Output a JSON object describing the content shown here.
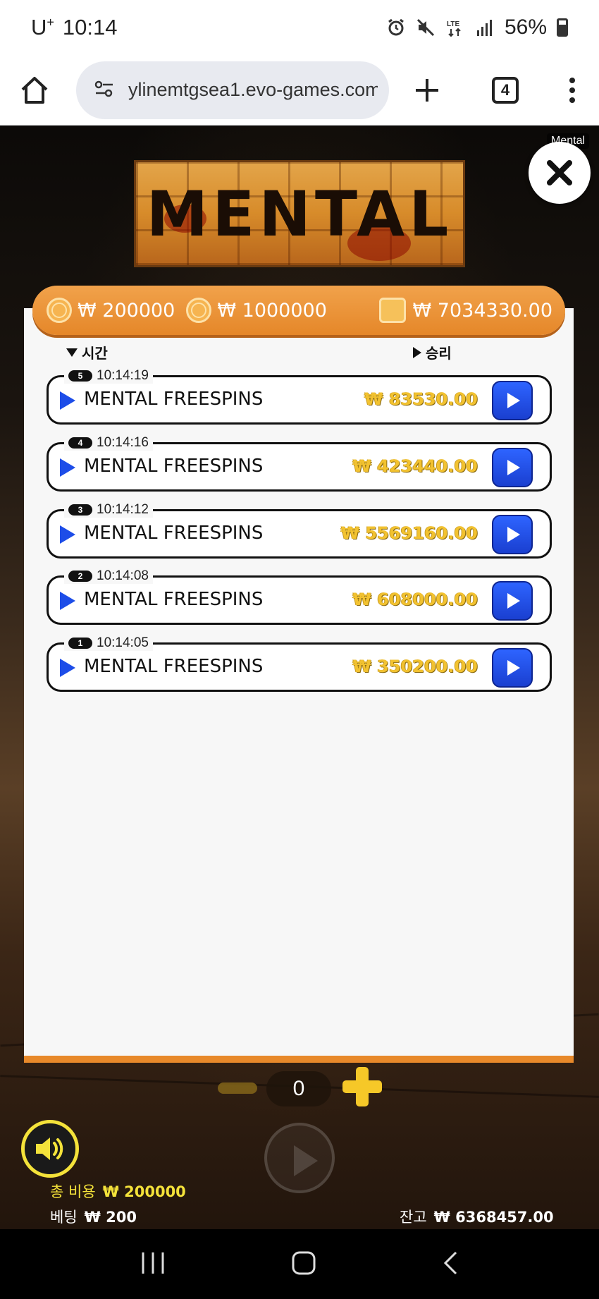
{
  "status_bar": {
    "carrier": "U",
    "carrier_sup": "+",
    "time": "10:14",
    "battery": "56%"
  },
  "browser": {
    "url": "ylinemtgsea1.evo-games.com",
    "tab_count": "4"
  },
  "game": {
    "logo_text": "MENTAL",
    "close_tooltip": "Mental",
    "header": {
      "bet_amount": "₩ 200000",
      "win_amount": "₩ 1000000",
      "balance": "₩ 7034330.00"
    },
    "columns": {
      "time": "시간",
      "win": "승리"
    },
    "history": [
      {
        "index": "5",
        "time": "10:14:19",
        "title": "MENTAL FREESPINS",
        "amount": "₩ 83530.00"
      },
      {
        "index": "4",
        "time": "10:14:16",
        "title": "MENTAL FREESPINS",
        "amount": "₩ 423440.00"
      },
      {
        "index": "3",
        "time": "10:14:12",
        "title": "MENTAL FREESPINS",
        "amount": "₩ 5569160.00"
      },
      {
        "index": "2",
        "time": "10:14:08",
        "title": "MENTAL FREESPINS",
        "amount": "₩ 608000.00"
      },
      {
        "index": "1",
        "time": "10:14:05",
        "title": "MENTAL FREESPINS",
        "amount": "₩ 350200.00"
      }
    ],
    "counter": "0",
    "total_cost_label": "총 비용",
    "total_cost": "₩ 200000",
    "bet_label": "베팅",
    "bet": "₩ 200",
    "balance_label": "잔고",
    "balance": "₩ 6368457.00"
  },
  "colors": {
    "accent": "#e58729",
    "play_blue": "#1d4de8",
    "gold": "#f2c230"
  }
}
